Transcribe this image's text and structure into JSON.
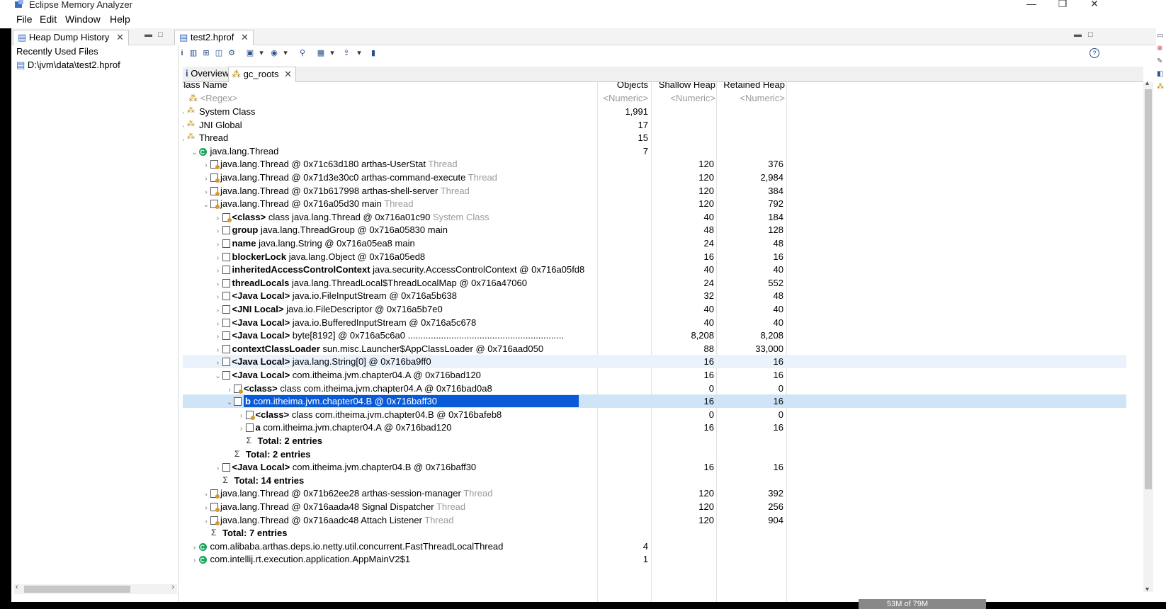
{
  "window": {
    "title": "Eclipse Memory Analyzer",
    "minimize": "—",
    "restore": "❐",
    "close": "✕"
  },
  "menu": [
    "File",
    "Edit",
    "Window",
    "Help"
  ],
  "left_panel": {
    "tab_label": "Heap Dump History",
    "recent_label": "Recently Used Files",
    "recent_file": "D:\\jvm\\data\\test2.hprof"
  },
  "editor": {
    "tab_label": "test2.hprof"
  },
  "subtabs": [
    "Overview",
    "gc_roots"
  ],
  "columns": [
    "Class Name",
    "Objects",
    "Shallow Heap",
    "Retained Heap"
  ],
  "filters": {
    "regex": "<Regex>",
    "numeric": "<Numeric>"
  },
  "rows": [
    {
      "indent": 0,
      "exp": "›",
      "icon": "grp",
      "parts": [
        [
          "System Class",
          ""
        ]
      ],
      "obj": "1,991",
      "sh": "",
      "ret": ""
    },
    {
      "indent": 0,
      "exp": "›",
      "icon": "grp",
      "parts": [
        [
          "JNI Global",
          ""
        ]
      ],
      "obj": "17",
      "sh": "",
      "ret": ""
    },
    {
      "indent": 0,
      "exp": "⌄",
      "icon": "grp",
      "parts": [
        [
          "Thread",
          ""
        ]
      ],
      "obj": "15",
      "sh": "",
      "ret": ""
    },
    {
      "indent": 1,
      "exp": "⌄",
      "icon": "cls",
      "parts": [
        [
          "java.lang.Thread",
          ""
        ]
      ],
      "obj": "7",
      "sh": "",
      "ret": ""
    },
    {
      "indent": 2,
      "exp": "›",
      "icon": "thr",
      "parts": [
        [
          "java.lang.Thread @ 0x71c63d180  arthas-UserStat ",
          ""
        ],
        [
          "Thread",
          "grey"
        ]
      ],
      "obj": "",
      "sh": "120",
      "ret": "376"
    },
    {
      "indent": 2,
      "exp": "›",
      "icon": "thr",
      "parts": [
        [
          "java.lang.Thread @ 0x71d3e30c0  arthas-command-execute ",
          ""
        ],
        [
          "Thread",
          "grey"
        ]
      ],
      "obj": "",
      "sh": "120",
      "ret": "2,984"
    },
    {
      "indent": 2,
      "exp": "›",
      "icon": "thr",
      "parts": [
        [
          "java.lang.Thread @ 0x71b617998  arthas-shell-server ",
          ""
        ],
        [
          "Thread",
          "grey"
        ]
      ],
      "obj": "",
      "sh": "120",
      "ret": "384"
    },
    {
      "indent": 2,
      "exp": "⌄",
      "icon": "thr",
      "parts": [
        [
          "java.lang.Thread @ 0x716a05d30  main ",
          ""
        ],
        [
          "Thread",
          "grey"
        ]
      ],
      "obj": "",
      "sh": "120",
      "ret": "792"
    },
    {
      "indent": 3,
      "exp": "›",
      "icon": "thr",
      "parts": [
        [
          "<class>",
          "b"
        ],
        [
          " class java.lang.Thread @ 0x716a01c90 ",
          ""
        ],
        [
          "System Class",
          "grey"
        ]
      ],
      "obj": "",
      "sh": "40",
      "ret": "184"
    },
    {
      "indent": 3,
      "exp": "›",
      "icon": "obj",
      "parts": [
        [
          "group",
          "b"
        ],
        [
          " java.lang.ThreadGroup @ 0x716a05830  main",
          ""
        ]
      ],
      "obj": "",
      "sh": "48",
      "ret": "128"
    },
    {
      "indent": 3,
      "exp": "›",
      "icon": "obj",
      "parts": [
        [
          "name",
          "b"
        ],
        [
          " java.lang.String @ 0x716a05ea8  main",
          ""
        ]
      ],
      "obj": "",
      "sh": "24",
      "ret": "48"
    },
    {
      "indent": 3,
      "exp": "›",
      "icon": "obj",
      "parts": [
        [
          "blockerLock",
          "b"
        ],
        [
          " java.lang.Object @ 0x716a05ed8",
          ""
        ]
      ],
      "obj": "",
      "sh": "16",
      "ret": "16"
    },
    {
      "indent": 3,
      "exp": "›",
      "icon": "obj",
      "parts": [
        [
          "inheritedAccessControlContext",
          "b"
        ],
        [
          " java.security.AccessControlContext @ 0x716a05fd8",
          ""
        ]
      ],
      "obj": "",
      "sh": "40",
      "ret": "40"
    },
    {
      "indent": 3,
      "exp": "›",
      "icon": "obj",
      "parts": [
        [
          "threadLocals",
          "b"
        ],
        [
          " java.lang.ThreadLocal$ThreadLocalMap @ 0x716a47060",
          ""
        ]
      ],
      "obj": "",
      "sh": "24",
      "ret": "552"
    },
    {
      "indent": 3,
      "exp": "›",
      "icon": "obj",
      "parts": [
        [
          "<Java Local>",
          "b"
        ],
        [
          " java.io.FileInputStream @ 0x716a5b638",
          ""
        ]
      ],
      "obj": "",
      "sh": "32",
      "ret": "48"
    },
    {
      "indent": 3,
      "exp": "›",
      "icon": "obj",
      "parts": [
        [
          "<JNI Local>",
          "b"
        ],
        [
          " java.io.FileDescriptor @ 0x716a5b7e0",
          ""
        ]
      ],
      "obj": "",
      "sh": "40",
      "ret": "40"
    },
    {
      "indent": 3,
      "exp": "›",
      "icon": "obj",
      "parts": [
        [
          "<Java Local>",
          "b"
        ],
        [
          " java.io.BufferedInputStream @ 0x716a5c678",
          ""
        ]
      ],
      "obj": "",
      "sh": "40",
      "ret": "40"
    },
    {
      "indent": 3,
      "exp": "›",
      "icon": "obj",
      "parts": [
        [
          "<Java Local>",
          "b"
        ],
        [
          " byte[8192] @ 0x716a5c6a0  .............................................................",
          ""
        ]
      ],
      "obj": "",
      "sh": "8,208",
      "ret": "8,208"
    },
    {
      "indent": 3,
      "exp": "›",
      "icon": "obj",
      "parts": [
        [
          "contextClassLoader",
          "b"
        ],
        [
          " sun.misc.Launcher$AppClassLoader @ 0x716aad050",
          ""
        ]
      ],
      "obj": "",
      "sh": "88",
      "ret": "33,000"
    },
    {
      "indent": 3,
      "exp": "›",
      "icon": "obj",
      "parts": [
        [
          "<Java Local>",
          "b"
        ],
        [
          " java.lang.String[0] @ 0x716ba9ff0",
          ""
        ]
      ],
      "obj": "",
      "sh": "16",
      "ret": "16",
      "state": "hover"
    },
    {
      "indent": 3,
      "exp": "⌄",
      "icon": "obj",
      "parts": [
        [
          "<Java Local>",
          "b"
        ],
        [
          " com.itheima.jvm.chapter04.A @ 0x716bad120",
          ""
        ]
      ],
      "obj": "",
      "sh": "16",
      "ret": "16"
    },
    {
      "indent": 4,
      "exp": "›",
      "icon": "thr",
      "parts": [
        [
          "<class>",
          "b"
        ],
        [
          " class com.itheima.jvm.chapter04.A @ 0x716bad0a8",
          ""
        ]
      ],
      "obj": "",
      "sh": "0",
      "ret": "0"
    },
    {
      "indent": 4,
      "exp": "⌄",
      "icon": "obj",
      "parts": [
        [
          "b",
          "b"
        ],
        [
          " com.itheima.jvm.chapter04.B @ 0x716baff30",
          ""
        ]
      ],
      "obj": "",
      "sh": "16",
      "ret": "16",
      "state": "selected"
    },
    {
      "indent": 5,
      "exp": "›",
      "icon": "thr",
      "parts": [
        [
          "<class>",
          "b"
        ],
        [
          " class com.itheima.jvm.chapter04.B @ 0x716bafeb8",
          ""
        ]
      ],
      "obj": "",
      "sh": "0",
      "ret": "0"
    },
    {
      "indent": 5,
      "exp": "›",
      "icon": "obj",
      "parts": [
        [
          "a",
          "b"
        ],
        [
          " com.itheima.jvm.chapter04.A @ 0x716bad120",
          ""
        ]
      ],
      "obj": "",
      "sh": "16",
      "ret": "16"
    },
    {
      "indent": 5,
      "exp": "",
      "icon": "sum",
      "parts": [
        [
          "Total: 2 entries",
          "b"
        ]
      ],
      "obj": "",
      "sh": "",
      "ret": ""
    },
    {
      "indent": 4,
      "exp": "",
      "icon": "sum",
      "parts": [
        [
          "Total: 2 entries",
          "b"
        ]
      ],
      "obj": "",
      "sh": "",
      "ret": ""
    },
    {
      "indent": 3,
      "exp": "›",
      "icon": "obj",
      "parts": [
        [
          "<Java Local>",
          "b"
        ],
        [
          " com.itheima.jvm.chapter04.B @ 0x716baff30",
          ""
        ]
      ],
      "obj": "",
      "sh": "16",
      "ret": "16"
    },
    {
      "indent": 3,
      "exp": "",
      "icon": "sum",
      "parts": [
        [
          "Total: 14 entries",
          "b"
        ]
      ],
      "obj": "",
      "sh": "",
      "ret": ""
    },
    {
      "indent": 2,
      "exp": "›",
      "icon": "thr",
      "parts": [
        [
          "java.lang.Thread @ 0x71b62ee28  arthas-session-manager ",
          ""
        ],
        [
          "Thread",
          "grey"
        ]
      ],
      "obj": "",
      "sh": "120",
      "ret": "392"
    },
    {
      "indent": 2,
      "exp": "›",
      "icon": "thr",
      "parts": [
        [
          "java.lang.Thread @ 0x716aada48  Signal Dispatcher ",
          ""
        ],
        [
          "Thread",
          "grey"
        ]
      ],
      "obj": "",
      "sh": "120",
      "ret": "256"
    },
    {
      "indent": 2,
      "exp": "›",
      "icon": "thr",
      "parts": [
        [
          "java.lang.Thread @ 0x716aadc48  Attach Listener ",
          ""
        ],
        [
          "Thread",
          "grey"
        ]
      ],
      "obj": "",
      "sh": "120",
      "ret": "904"
    },
    {
      "indent": 2,
      "exp": "",
      "icon": "sum",
      "parts": [
        [
          "Total: 7 entries",
          "b"
        ]
      ],
      "obj": "",
      "sh": "",
      "ret": ""
    },
    {
      "indent": 1,
      "exp": "›",
      "icon": "cls",
      "parts": [
        [
          "com.alibaba.arthas.deps.io.netty.util.concurrent.FastThreadLocalThread",
          ""
        ]
      ],
      "obj": "4",
      "sh": "",
      "ret": ""
    },
    {
      "indent": 1,
      "exp": "›",
      "icon": "cls",
      "parts": [
        [
          "com.intellij.rt.execution.application.AppMainV2$1",
          ""
        ]
      ],
      "obj": "1",
      "sh": "",
      "ret": ""
    }
  ],
  "status": {
    "heap": "53M of 79M"
  }
}
